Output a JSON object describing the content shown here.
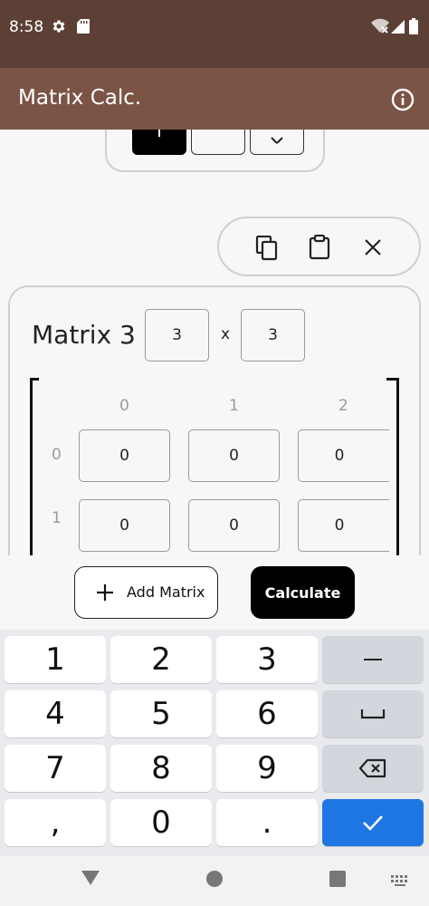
{
  "status_bar": {
    "time": "8:58"
  },
  "app_bar": {
    "title": "Matrix Calc."
  },
  "matrix": {
    "title": "Matrix 3",
    "rows": "3",
    "separator": "x",
    "cols": "3",
    "col_headers": [
      "0",
      "1",
      "2"
    ],
    "row_headers": [
      "0",
      "1"
    ],
    "cells": [
      [
        "0",
        "0",
        "0"
      ],
      [
        "0",
        "0",
        "0"
      ]
    ]
  },
  "actions": {
    "add_matrix_label": "Add Matrix",
    "calculate_label": "Calculate"
  },
  "keyboard": {
    "rows": [
      [
        "1",
        "2",
        "3",
        "−"
      ],
      [
        "4",
        "5",
        "6",
        "␣"
      ],
      [
        "7",
        "8",
        "9",
        "⌫"
      ],
      [
        ",",
        "0",
        ".",
        "✓"
      ]
    ]
  },
  "colors": {
    "status_bar": "#5d4035",
    "app_bar": "#7b5446",
    "primary_button": "#000000",
    "enter_key": "#1e76e3"
  }
}
